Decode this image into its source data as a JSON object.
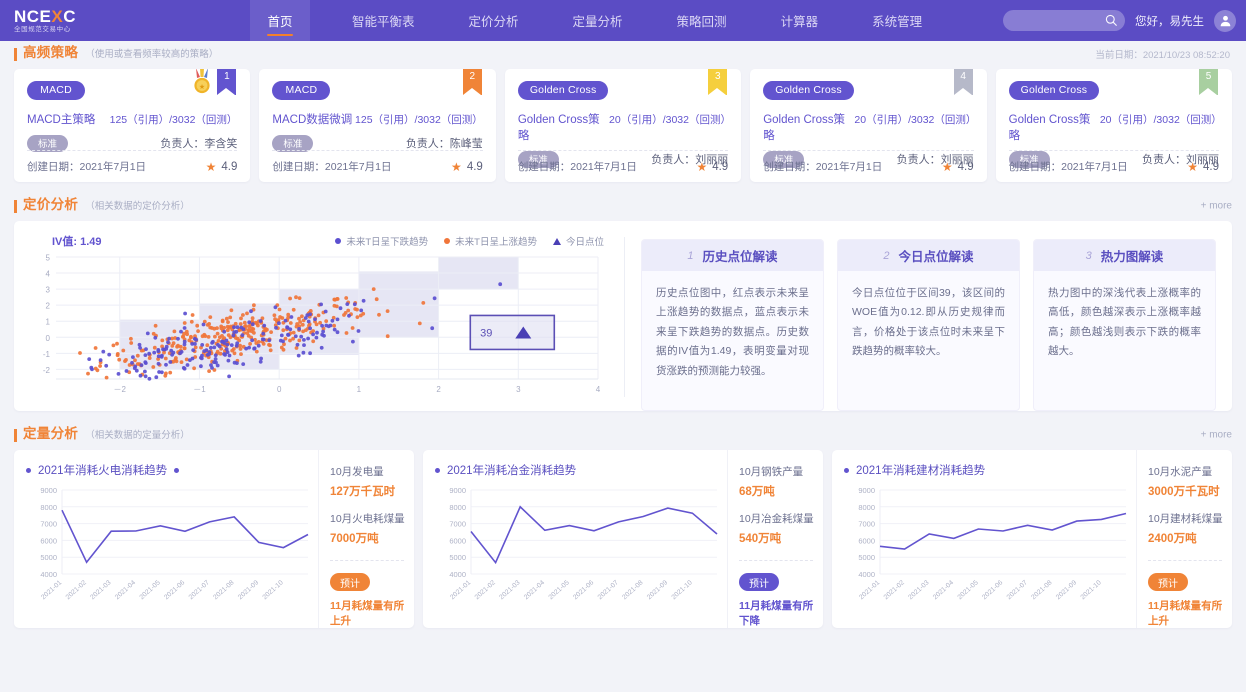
{
  "brand": {
    "logo_main_a": "NCE",
    "logo_main_x": "X",
    "logo_main_b": "C",
    "logo_sub": "全国规范交易中心"
  },
  "header": {
    "nav": [
      {
        "label": "首页",
        "active": true
      },
      {
        "label": "智能平衡表",
        "active": false
      },
      {
        "label": "定价分析",
        "active": false
      },
      {
        "label": "定量分析",
        "active": false
      },
      {
        "label": "策略回测",
        "active": false
      },
      {
        "label": "计算器",
        "active": false
      },
      {
        "label": "系统管理",
        "active": false
      }
    ],
    "search": {
      "value": "",
      "placeholder": "",
      "icon": "search-icon"
    },
    "greeting": "您好，易先生",
    "avatar_icon": "user-avatar-icon"
  },
  "sections": {
    "high_freq": {
      "title": "高频策略",
      "subtitle": "（使用或查看频率较高的策略）",
      "current_date_label": "当前日期：2021/10/23  08:52:20"
    },
    "pricing": {
      "title": "定价分析",
      "subtitle": "（相关数据的定价分析）",
      "more": "+ more"
    },
    "quant": {
      "title": "定量分析",
      "subtitle": "（相关数据的定量分析）",
      "more": "+ more"
    }
  },
  "strategy_cards": [
    {
      "tag": "MACD",
      "name": "MACD主策略",
      "cite": "125（引用）/3032（回测）",
      "badge": "标准",
      "owner": "负责人：李含笑",
      "created": "创建日期：2021年7月1日",
      "rating": "4.9",
      "rank": "1",
      "ribbon_color": "#6254cf",
      "has_medal": true
    },
    {
      "tag": "MACD",
      "name": "MACD数据微调",
      "cite": "125（引用）/3032（回测）",
      "badge": "标准",
      "owner": "负责人：陈峰莹",
      "created": "创建日期：2021年7月1日",
      "rating": "4.9",
      "rank": "2",
      "ribbon_color": "#f08437",
      "has_medal": false
    },
    {
      "tag": "Golden Cross",
      "name": "Golden Cross策略",
      "cite": "20（引用）/3032（回测）",
      "badge": "标准",
      "owner": "负责人：刘丽丽",
      "created": "创建日期：2021年7月1日",
      "rating": "4.9",
      "rank": "3",
      "ribbon_color": "#f5cf3d",
      "has_medal": false
    },
    {
      "tag": "Golden Cross",
      "name": "Golden Cross策略",
      "cite": "20（引用）/3032（回测）",
      "badge": "标准",
      "owner": "负责人：刘丽丽",
      "created": "创建日期：2021年7月1日",
      "rating": "4.9",
      "rank": "4",
      "ribbon_color": "#b6b9c9",
      "has_medal": false
    },
    {
      "tag": "Golden Cross",
      "name": "Golden Cross策略",
      "cite": "20（引用）/3032（回测）",
      "badge": "标准",
      "owner": "负责人：刘丽丽",
      "created": "创建日期：2021年7月1日",
      "rating": "4.9",
      "rank": "5",
      "ribbon_color": "#a8cfa0",
      "has_medal": false
    }
  ],
  "pricing_readouts": [
    {
      "num": "1",
      "title": "历史点位解读",
      "body": "历史点位图中，红点表示未来呈上涨趋势的数据点，蓝点表示未来呈下跌趋势的数据点。历史数据的IV值为1.49，表明变量对现货涨跌的预测能力较强。"
    },
    {
      "num": "2",
      "title": "今日点位解读",
      "body": "今日点位位于区间39，该区间的WOE值为0.12.即从历史规律而言，价格处于该点位时未来呈下跌趋势的概率较大。"
    },
    {
      "num": "3",
      "title": "热力图解读",
      "body": "热力图中的深浅代表上涨概率的高低，颜色越深表示上涨概率越高；颜色越浅则表示下跌的概率越大。"
    }
  ],
  "chart_data": [
    {
      "type": "scatter",
      "title": "",
      "annotation_iv": "IV值: 1.49",
      "xlabel": "",
      "ylabel": "",
      "xlim": [
        -2.8,
        4
      ],
      "ylim": [
        -2.6,
        5
      ],
      "xticks": [
        "－2",
        "－1",
        "0",
        "1",
        "2",
        "3",
        "4"
      ],
      "xtick_values": [
        -2,
        -1,
        0,
        1,
        2,
        3,
        4
      ],
      "yticks": [
        "5",
        "4",
        "3",
        "2",
        "1",
        "0",
        "-1",
        "-2"
      ],
      "ytick_values": [
        5,
        4,
        3,
        2,
        1,
        0,
        -1,
        -2
      ],
      "grid": true,
      "legend_position": "top-right",
      "legend": [
        {
          "name": "未来T日呈下跌趋势",
          "marker": "circle",
          "color": "#5b4fd0"
        },
        {
          "name": "未来T日呈上涨趋势",
          "marker": "circle",
          "color": "#f0753a"
        },
        {
          "name": "今日点位",
          "marker": "triangle",
          "color": "#4a3fb5"
        }
      ],
      "today_marker": {
        "label": "39",
        "x": 3.0,
        "y": 0.3
      },
      "heatmap_bins": [
        {
          "x0": -2.0,
          "x1": -1.0,
          "y0": -2.0,
          "y1": 1.1,
          "alpha": 0.22
        },
        {
          "x0": -1.0,
          "x1": 0.0,
          "y0": -2.0,
          "y1": 2.1,
          "alpha": 0.22
        },
        {
          "x0": 0.0,
          "x1": 1.0,
          "y0": -1.1,
          "y1": 3.0,
          "alpha": 0.22
        },
        {
          "x0": 1.0,
          "x1": 2.0,
          "y0": 0.0,
          "y1": 4.1,
          "alpha": 0.22
        },
        {
          "x0": 2.0,
          "x1": 3.0,
          "y0": 3.0,
          "y1": 5.0,
          "alpha": 0.22
        }
      ]
    },
    {
      "type": "line",
      "title": "2021年消耗火电消耗趋势",
      "categories": [
        "2021-01",
        "2021-02",
        "2021-03",
        "2021-04",
        "2021-05",
        "2021-06",
        "2021-07",
        "2021-08",
        "2021-09",
        "2021-10"
      ],
      "values": [
        7800,
        4700,
        6550,
        6560,
        6870,
        6540,
        7100,
        7400,
        5880,
        5570
      ],
      "values_extra": 6350,
      "ylim": [
        4000,
        9000
      ],
      "yticks": [
        9000,
        8000,
        7000,
        6000,
        5000,
        4000
      ],
      "series_color": "#6254cf",
      "grid": true
    },
    {
      "type": "line",
      "title": "2021年消耗冶金消耗趋势",
      "categories": [
        "2021-01",
        "2021-02",
        "2021-03",
        "2021-04",
        "2021-05",
        "2021-06",
        "2021-07",
        "2021-08",
        "2021-09",
        "2021-10"
      ],
      "values": [
        6530,
        4680,
        8000,
        6600,
        6880,
        6570,
        7100,
        7420,
        7920,
        7620
      ],
      "values_extra": 6380,
      "ylim": [
        4000,
        9000
      ],
      "yticks": [
        9000,
        8000,
        7000,
        6000,
        5000,
        4000
      ],
      "series_color": "#6254cf",
      "grid": true
    },
    {
      "type": "line",
      "title": "2021年消耗建材消耗趋势",
      "categories": [
        "2021-01",
        "2021-02",
        "2021-03",
        "2021-04",
        "2021-05",
        "2021-06",
        "2021-07",
        "2021-08",
        "2021-09",
        "2021-10"
      ],
      "values": [
        5650,
        5480,
        6380,
        6120,
        6680,
        6560,
        6900,
        6620,
        7150,
        7250
      ],
      "values_extra": 7600,
      "ylim": [
        4000,
        9000
      ],
      "yticks": [
        9000,
        8000,
        7000,
        6000,
        5000,
        4000
      ],
      "series_color": "#6254cf",
      "grid": true
    }
  ],
  "quant_cards": [
    {
      "title": "2021年消耗火电消耗趋势",
      "stat1_label": "10月发电量",
      "stat1_value": "127万千瓦时",
      "stat2_label": "10月火电耗煤量",
      "stat2_value": "7000万吨",
      "pill": "预计",
      "pill_color": "#f08437",
      "note": "11月耗煤量有所上升",
      "value_color": "#f08437",
      "note_color": "#f08437",
      "title_marker_both": true
    },
    {
      "title": "2021年消耗冶金消耗趋势",
      "stat1_label": "10月钢铁产量",
      "stat1_value": "68万吨",
      "stat2_label": "10月冶金耗煤量",
      "stat2_value": "540万吨",
      "pill": "预计",
      "pill_color": "#6254cf",
      "note": "11月耗煤量有所下降",
      "value_color": "#f08437",
      "note_color": "#6254cf",
      "title_marker_both": false
    },
    {
      "title": "2021年消耗建材消耗趋势",
      "stat1_label": "10月水泥产量",
      "stat1_value": "3000万千瓦时",
      "stat2_label": "10月建材耗煤量",
      "stat2_value": "2400万吨",
      "pill": "预计",
      "pill_color": "#f08437",
      "note": "11月耗煤量有所上升",
      "value_color": "#f08437",
      "note_color": "#f08437",
      "title_marker_both": false
    }
  ]
}
